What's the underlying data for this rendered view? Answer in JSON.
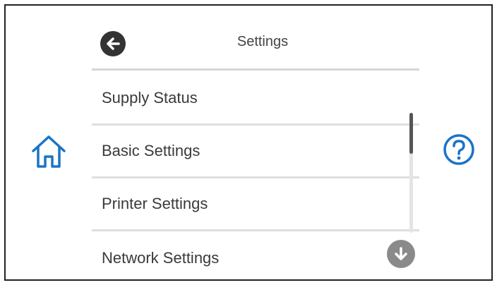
{
  "header": {
    "title": "Settings",
    "back_icon": "arrow-left-icon"
  },
  "menu": {
    "items": [
      {
        "label": "Supply Status"
      },
      {
        "label": "Basic Settings"
      },
      {
        "label": "Printer Settings"
      },
      {
        "label": "Network Settings"
      }
    ]
  },
  "nav": {
    "home_icon": "home-icon",
    "help_icon": "help-icon",
    "scroll_down_icon": "arrow-down-icon"
  },
  "scroll": {
    "position_fraction": 0.0,
    "visible_fraction": 0.34
  },
  "colors": {
    "accent": "#1a73c8",
    "back_button": "#333333",
    "scroll_button": "#8a8a8a"
  }
}
